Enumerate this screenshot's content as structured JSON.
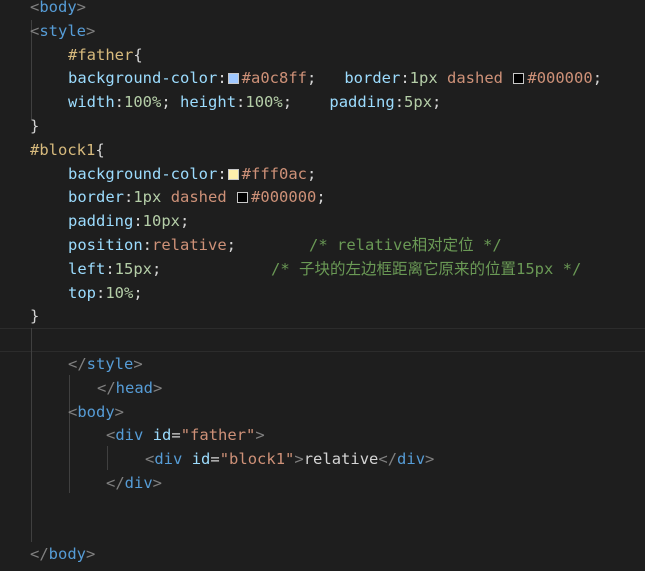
{
  "code": {
    "l1": {
      "open": "<",
      "tag": "body",
      "close": ">"
    },
    "l2": {
      "open": "<",
      "tag": "style",
      "close": ">"
    },
    "l3": {
      "selector": "#father",
      "brace": "{"
    },
    "l4": {
      "p1": "background-color",
      "c1": ":",
      "v1": "#a0c8ff",
      "s1": ";",
      "p2": "border",
      "c2": ":",
      "n2": "1px",
      "w2": "dashed",
      "v2": "#000000",
      "s2": ";"
    },
    "l5": {
      "p1": "width",
      "c1": ":",
      "v1": "100%",
      "s1": ";",
      "p2": "height",
      "c2": ":",
      "v2": "100%",
      "s2": ";",
      "p3": "padding",
      "c3": ":",
      "v3": "5px",
      "s3": ";"
    },
    "l6": {
      "brace": "}"
    },
    "l7": {
      "selector": "#block1",
      "brace": "{"
    },
    "l8": {
      "p1": "background-color",
      "c1": ":",
      "v1": "#fff0ac",
      "s1": ";"
    },
    "l9": {
      "p1": "border",
      "c1": ":",
      "n1": "1px",
      "w1": "dashed",
      "v1": "#000000",
      "s1": ";"
    },
    "l10": {
      "p1": "padding",
      "c1": ":",
      "v1": "10px",
      "s1": ";"
    },
    "l11": {
      "p1": "position",
      "c1": ":",
      "v1": "relative",
      "s1": ";",
      "comment": "/* relative相对定位 */"
    },
    "l12": {
      "p1": "left",
      "c1": ":",
      "v1": "15px",
      "s1": ";",
      "comment": "/* 子块的左边框距离它原来的位置15px */"
    },
    "l13": {
      "p1": "top",
      "c1": ":",
      "v1": "10%",
      "s1": ";"
    },
    "l14": {
      "brace": "}"
    },
    "l16": {
      "open": "</",
      "tag": "style",
      "close": ">"
    },
    "l17": {
      "open": "</",
      "tag": "head",
      "close": ">"
    },
    "l18": {
      "open": "<",
      "tag": "body",
      "close": ">"
    },
    "l19": {
      "open": "<",
      "tag": "div",
      "attr": "id",
      "eq": "=",
      "val": "\"father\"",
      "close": ">"
    },
    "l20": {
      "open": "<",
      "tag": "div",
      "attr": "id",
      "eq": "=",
      "val": "\"block1\"",
      "close": ">",
      "text": "relative",
      "open2": "</",
      "tag2": "div",
      "close2": ">"
    },
    "l21": {
      "open": "</",
      "tag": "div",
      "close": ">"
    },
    "l24": {
      "open": "</",
      "tag": "body",
      "close": ">"
    }
  },
  "swatches": {
    "father_bg": "#a0c8ff",
    "father_border": "#000000",
    "block1_bg": "#fff0ac",
    "block1_border": "#000000"
  }
}
